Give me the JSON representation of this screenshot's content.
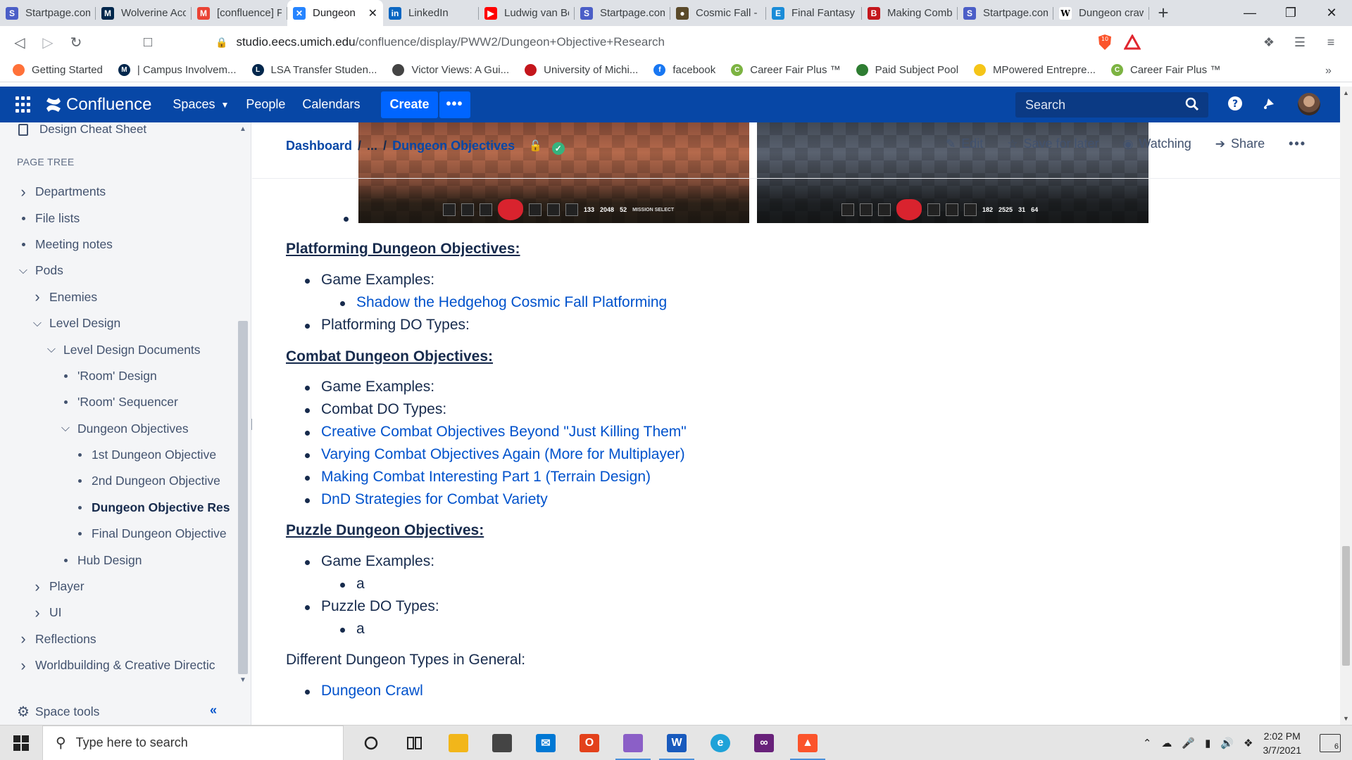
{
  "browser": {
    "tabs": [
      {
        "title": "Startpage.com",
        "icon": "startpage-icon",
        "color": "#4b5ec7",
        "glyph": "S"
      },
      {
        "title": "Wolverine Access",
        "icon": "umich-icon",
        "color": "#00274c",
        "glyph": "M"
      },
      {
        "title": "[confluence] PWW2",
        "icon": "gmail-icon",
        "color": "#ea4335",
        "glyph": "M"
      },
      {
        "title": "Dungeon",
        "icon": "confluence-icon",
        "color": "#2684ff",
        "glyph": "✕",
        "active": true
      },
      {
        "title": "LinkedIn",
        "icon": "linkedin-icon",
        "color": "#0a66c2",
        "glyph": "in"
      },
      {
        "title": "Ludwig van Beethoven",
        "icon": "youtube-icon",
        "color": "#ff0000",
        "glyph": "▶"
      },
      {
        "title": "Startpage.com",
        "icon": "startpage-icon",
        "color": "#4b5ec7",
        "glyph": "S"
      },
      {
        "title": "Cosmic Fall - Sonic",
        "icon": "sonic-icon",
        "color": "#5a4a2a",
        "glyph": "●"
      },
      {
        "title": "Final Fantasy",
        "icon": "e-icon",
        "color": "#1a8cd8",
        "glyph": "E"
      },
      {
        "title": "Making Combat",
        "icon": "b-icon",
        "color": "#c4161c",
        "glyph": "B"
      },
      {
        "title": "Startpage.com",
        "icon": "startpage-icon",
        "color": "#4b5ec7",
        "glyph": "S"
      },
      {
        "title": "Dungeon crawl",
        "icon": "wikipedia-icon",
        "color": "#ffffff",
        "glyph": "W"
      }
    ],
    "url_host": "studio.eecs.umich.edu",
    "url_path": "/confluence/display/PWW2/Dungeon+Objective+Research",
    "brave_shield_count": "10",
    "bookmarks": [
      {
        "label": "Getting Started",
        "icon": "firefox-icon",
        "color": "#ff7139",
        "glyph": ""
      },
      {
        "label": "| Campus Involvem...",
        "icon": "umich-icon",
        "color": "#00274c",
        "glyph": "M"
      },
      {
        "label": "LSA Transfer Studen...",
        "icon": "lsa-icon",
        "color": "#00274c",
        "glyph": "L"
      },
      {
        "label": "Victor Views: A Gui...",
        "icon": "victor-icon",
        "color": "#444444",
        "glyph": ""
      },
      {
        "label": "University of Michi...",
        "icon": "mail-icon",
        "color": "#c4161c",
        "glyph": ""
      },
      {
        "label": "facebook",
        "icon": "facebook-icon",
        "color": "#1877f2",
        "glyph": "f"
      },
      {
        "label": "Career Fair Plus ™",
        "icon": "cfp-icon",
        "color": "#7cb342",
        "glyph": "C"
      },
      {
        "label": "Paid Subject Pool",
        "icon": "subjectpool-icon",
        "color": "#2e7d32",
        "glyph": ""
      },
      {
        "label": "MPowered Entrepre...",
        "icon": "mpowered-icon",
        "color": "#f5c518",
        "glyph": ""
      },
      {
        "label": "Career Fair Plus ™",
        "icon": "cfp-icon",
        "color": "#7cb342",
        "glyph": "C"
      }
    ]
  },
  "confluence": {
    "logo": "Confluence",
    "nav": {
      "spaces": "Spaces",
      "people": "People",
      "calendars": "Calendars",
      "create": "Create"
    },
    "search_placeholder": "Search"
  },
  "sidebar": {
    "top_item": "Design Cheat Sheet",
    "page_tree_heading": "PAGE TREE",
    "tree": [
      {
        "label": "Departments",
        "level": 0,
        "marker": "chevron-right"
      },
      {
        "label": "File lists",
        "level": 0,
        "marker": "bullet"
      },
      {
        "label": "Meeting notes",
        "level": 0,
        "marker": "bullet"
      },
      {
        "label": "Pods",
        "level": 0,
        "marker": "chevron-down"
      },
      {
        "label": "Enemies",
        "level": 1,
        "marker": "chevron-right"
      },
      {
        "label": "Level Design",
        "level": 1,
        "marker": "chevron-down"
      },
      {
        "label": "Level Design Documents",
        "level": 2,
        "marker": "chevron-down"
      },
      {
        "label": "'Room' Design",
        "level": 3,
        "marker": "bullet"
      },
      {
        "label": "'Room' Sequencer",
        "level": 3,
        "marker": "bullet"
      },
      {
        "label": "Dungeon Objectives",
        "level": 3,
        "marker": "chevron-down"
      },
      {
        "label": "1st Dungeon Objective",
        "level": 4,
        "marker": "bullet"
      },
      {
        "label": "2nd Dungeon Objective",
        "level": 4,
        "marker": "bullet"
      },
      {
        "label": "Dungeon Objective Res",
        "level": 4,
        "marker": "bullet",
        "current": true
      },
      {
        "label": "Final Dungeon Objective",
        "level": 4,
        "marker": "bullet"
      },
      {
        "label": "Hub Design",
        "level": 3,
        "marker": "bullet"
      },
      {
        "label": "Player",
        "level": 1,
        "marker": "chevron-right"
      },
      {
        "label": "UI",
        "level": 1,
        "marker": "chevron-right"
      },
      {
        "label": "Reflections",
        "level": 0,
        "marker": "chevron-right"
      },
      {
        "label": "Worldbuilding & Creative Directic",
        "level": 0,
        "marker": "chevron-right"
      }
    ],
    "space_tools": "Space tools"
  },
  "page": {
    "breadcrumb": {
      "root": "Dashboard",
      "ellipsis": "...",
      "current": "Dungeon Objectives"
    },
    "actions": {
      "edit": "Edit",
      "save": "Save for later",
      "watch": "Watching",
      "share": "Share"
    },
    "hud_left": {
      "count_a": "133",
      "count_b": "2048",
      "count_c": "52",
      "label": "MISSION SELECT"
    },
    "hud_right": {
      "count_a": "182",
      "count_b": "2525",
      "count_c": "31",
      "count_d": "64"
    },
    "platforming": {
      "heading": "Platforming Dungeon Objectives:",
      "examples_label": "Game Examples:",
      "example_link": "Shadow the Hedgehog Cosmic Fall Platforming",
      "types_label": "Platforming DO Types:"
    },
    "combat": {
      "heading": "Combat Dungeon Objectives:",
      "examples_label": "Game Examples:",
      "types_label": "Combat DO Types:",
      "links": [
        "Creative Combat Objectives Beyond \"Just Killing Them\"",
        "Varying Combat Objectives Again (More for Multiplayer)",
        "Making Combat Interesting Part 1 (Terrain Design)",
        "DnD Strategies for Combat Variety"
      ]
    },
    "puzzle": {
      "heading": "Puzzle Dungeon Objectives:",
      "examples_label": "Game Examples:",
      "example_value": "a",
      "types_label": "Puzzle DO Types:",
      "types_value": "a"
    },
    "general": {
      "heading": "Different Dungeon Types in General:",
      "link": "Dungeon Crawl"
    }
  },
  "taskbar": {
    "search_placeholder": "Type here to search",
    "time": "2:02 PM",
    "date": "3/7/2021",
    "notifications": "6"
  }
}
